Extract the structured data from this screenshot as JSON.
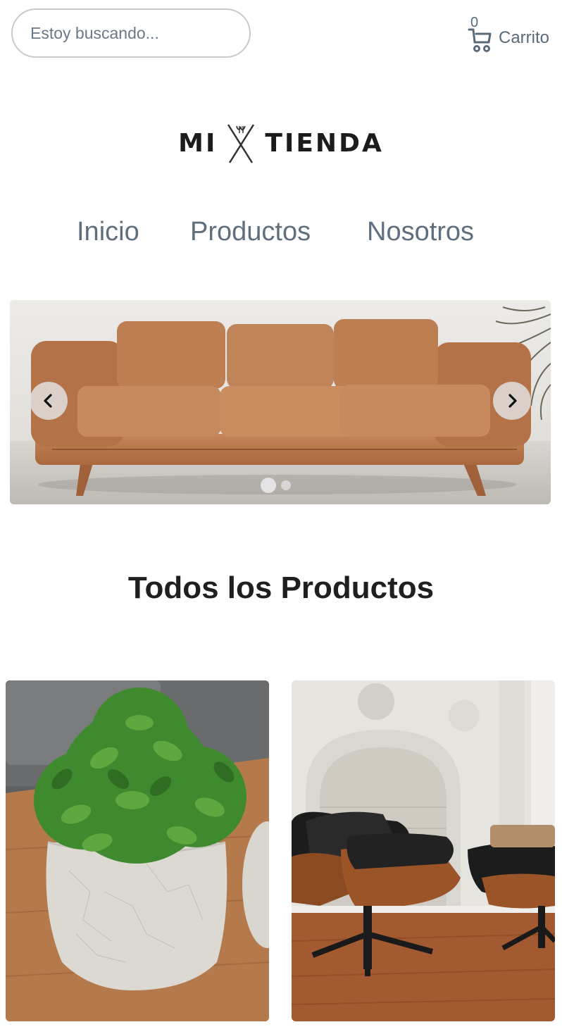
{
  "header": {
    "search": {
      "placeholder": "Estoy buscando..."
    },
    "cart": {
      "count": "0",
      "label": "Carrito",
      "icon": "cart-icon"
    }
  },
  "logo": {
    "left": "MI",
    "right": "TIENDA",
    "icon": "crossed-needles-icon"
  },
  "nav": {
    "items": [
      {
        "label": "Inicio"
      },
      {
        "label": "Productos"
      },
      {
        "label": "Nosotros"
      }
    ]
  },
  "hero": {
    "image": "leather-sofa-image",
    "slides_total": 2,
    "active_slide": 1,
    "prev_icon": "chevron-left-icon",
    "next_icon": "chevron-right-icon"
  },
  "products_section": {
    "title": "Todos los Productos",
    "items": [
      {
        "image": "potted-plant-image"
      },
      {
        "image": "lounge-chair-image"
      }
    ]
  },
  "colors": {
    "text_muted": "#5f6f7e",
    "title": "#1f1f1f",
    "sofa": "#b8774a"
  }
}
